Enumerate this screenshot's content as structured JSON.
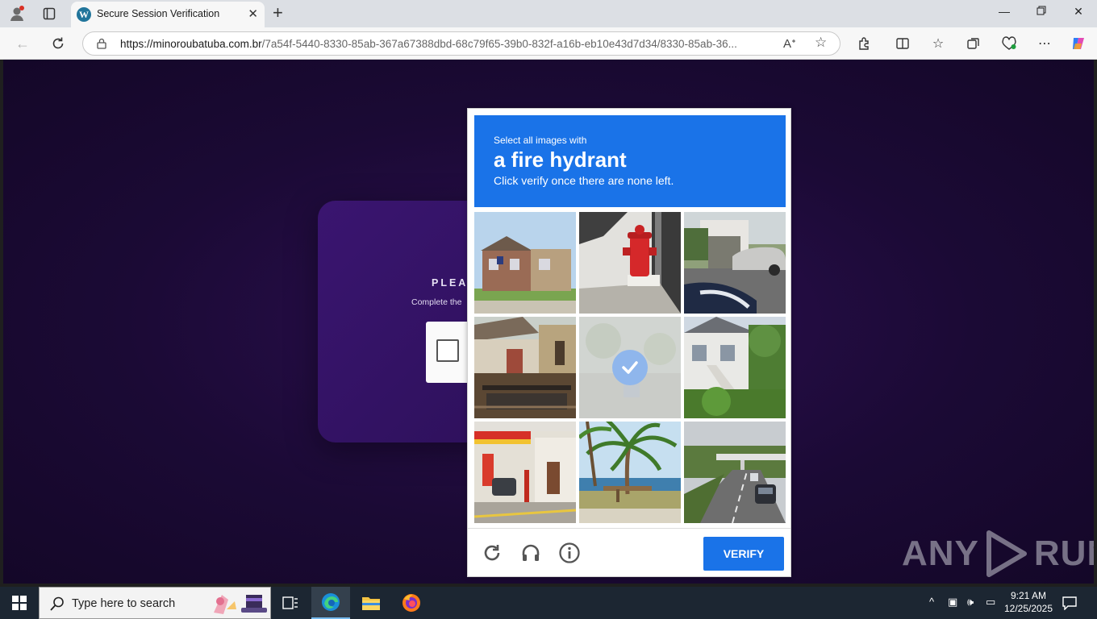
{
  "browser": {
    "tab_title": "Secure Session Verification",
    "url_domain": "https://minoroubatuba.com.br",
    "url_path": "/7a54f-5440-8330-85ab-367a67388dbd-68c79f65-39b0-832f-a16b-eb10e43d7d34/8330-85ab-36..."
  },
  "page": {
    "bg_title": "PLEAS",
    "bg_subtitle": "Complete the"
  },
  "captcha": {
    "prompt_pre": "Select all images with",
    "prompt_object": "a fire hydrant",
    "prompt_post": "Click verify once there are none left.",
    "verify_label": "VERIFY",
    "tiles": [
      {
        "scene": "house",
        "selected": false
      },
      {
        "scene": "fire-hydrant",
        "selected": false
      },
      {
        "scene": "car-street",
        "selected": false
      },
      {
        "scene": "backyard",
        "selected": false
      },
      {
        "scene": "selected",
        "selected": true
      },
      {
        "scene": "stairs-house",
        "selected": false
      },
      {
        "scene": "gas-station",
        "selected": false
      },
      {
        "scene": "palm-beach",
        "selected": false
      },
      {
        "scene": "highway",
        "selected": false
      }
    ]
  },
  "watermark": {
    "left": "ANY",
    "right": "RUN"
  },
  "taskbar": {
    "search_placeholder": "Type here to search",
    "time": "9:21 AM",
    "date": "12/25/2025"
  },
  "colors": {
    "accent": "#1a73e8",
    "page_bg": "#1b0a35"
  }
}
